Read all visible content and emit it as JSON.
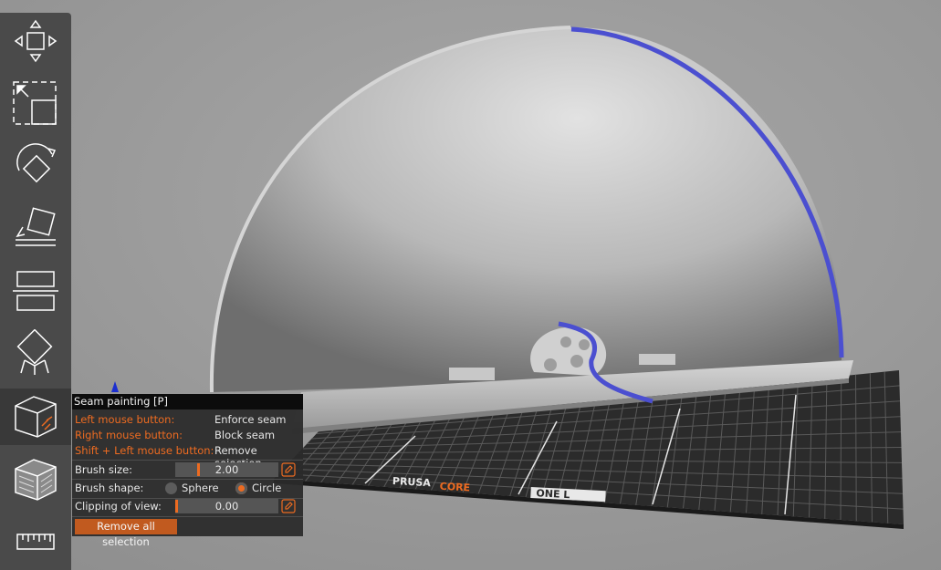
{
  "toolbar": {
    "tools": [
      {
        "name": "move-tool",
        "icon": "move-arrows-icon"
      },
      {
        "name": "scale-tool",
        "icon": "scale-icon"
      },
      {
        "name": "rotate-tool",
        "icon": "rotate-icon"
      },
      {
        "name": "place-on-face-tool",
        "icon": "place-on-face-icon"
      },
      {
        "name": "cut-tool",
        "icon": "cut-icon"
      },
      {
        "name": "support-painting-tool",
        "icon": "support-painting-icon"
      },
      {
        "name": "seam-painting-tool",
        "icon": "seam-painting-icon",
        "active": true
      },
      {
        "name": "mmu-painting-tool",
        "icon": "mmu-painting-icon"
      },
      {
        "name": "measure-tool",
        "icon": "ruler-icon"
      }
    ]
  },
  "gizmo": {
    "title": "Seam painting [P]",
    "instructions": [
      {
        "key": "Left mouse button:",
        "action": "Enforce seam"
      },
      {
        "key": "Right mouse button:",
        "action": "Block seam"
      },
      {
        "key": "Shift + Left mouse button:",
        "action": "Remove selection"
      }
    ],
    "brush_size_label": "Brush size:",
    "brush_size_value": "2.00",
    "brush_size_fraction": 0.22,
    "brush_shape_label": "Brush shape:",
    "brush_shape_options": [
      "Sphere",
      "Circle"
    ],
    "brush_shape_selected": "Circle",
    "clipping_label": "Clipping of view:",
    "clipping_value": "0.00",
    "clipping_fraction": 0.0,
    "remove_all_label": "Remove all selection"
  },
  "bed": {
    "logo_left": "PRUSA",
    "logo_mid": "CORE",
    "logo_right": "ONE L"
  },
  "colors": {
    "accent": "#ed6b21",
    "seam": "#4b4fd0",
    "background": "#9b9b9b",
    "toolbar": "#4a4a4a"
  }
}
